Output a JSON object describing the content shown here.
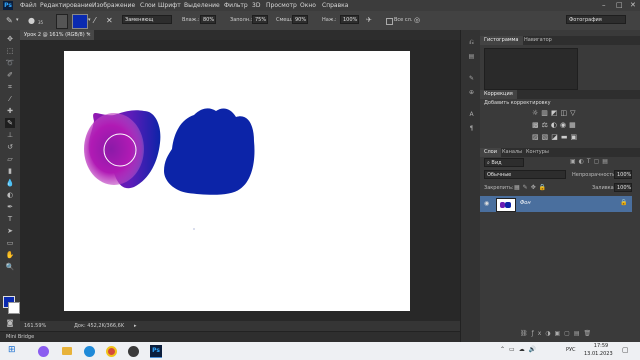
{
  "app": {
    "logo": "Ps"
  },
  "menu": [
    "Файл",
    "Редактирование",
    "Изображение",
    "Слои",
    "Шрифт",
    "Выделение",
    "Фильтр",
    "3D",
    "Просмотр",
    "Окно",
    "Справка"
  ],
  "window_controls": {
    "minimize": "–",
    "maximize": "□",
    "close": "✕"
  },
  "options": {
    "brush_size": "35",
    "mode_value": "Заменяющ",
    "opacity_label": "Влаж.:",
    "opacity_value": "80%",
    "fill_label": "Заполн.:",
    "fill_value": "75%",
    "mix_label": "Смеш.:",
    "mix_value": "90%",
    "flow_label": "Наж.:",
    "flow_value": "100%",
    "all_layers_label": "Все сл.",
    "workspace": "Фотография",
    "brush_color": "#0a2db0"
  },
  "document": {
    "tab_title": "Урок 2 @ 161% (RGB/8) *",
    "close_icon": "×",
    "zoom": "161.59%",
    "doc_info": "Док: 452,2K/366,6K"
  },
  "bridge": {
    "label": "Mini Bridge"
  },
  "panels": {
    "top_tabs": [
      "Гистограмма",
      "Навигатор"
    ],
    "adjust_tab": "Коррекция",
    "adjust_hint": "Добавить корректировку",
    "layers_tabs": [
      "Слои",
      "Каналы",
      "Контуры"
    ],
    "kind_label": "Вид",
    "blend_mode": "Обычные",
    "opacity_label": "Непрозрачность:",
    "opacity_value": "100%",
    "lock_label": "Закрепить:",
    "fill_label": "Заливка:",
    "fill_value": "100%",
    "layer_name": "Фон"
  },
  "taskbar": {
    "lang": "РУС",
    "time": "17:59",
    "date": "13.01.2023"
  },
  "colors": {
    "blue_blob": "#0c24a8",
    "magenta": "#a018b0",
    "foreground": "#0a2ab0",
    "background": "#ffffff"
  }
}
